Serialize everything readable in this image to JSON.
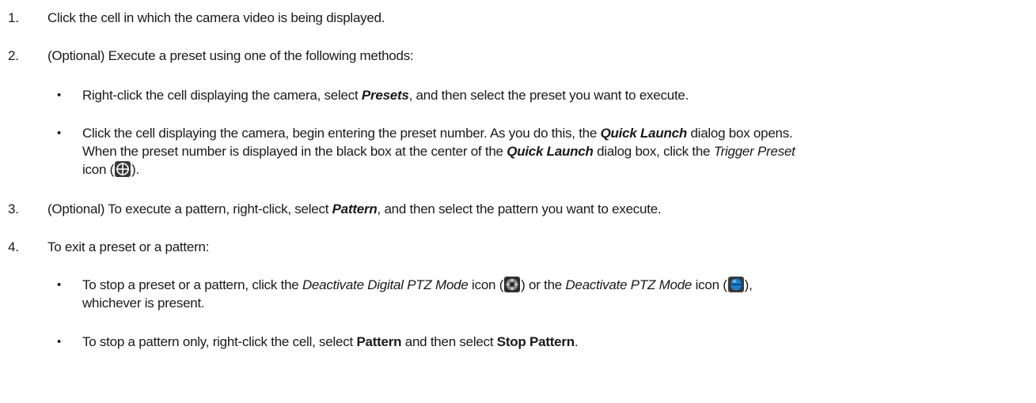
{
  "steps": [
    {
      "number": "1.",
      "text": "Click the cell in which the camera video is being displayed."
    },
    {
      "number": "2.",
      "text": "(Optional) Execute a preset using one of the following methods:",
      "bullets": [
        {
          "pre": "Right-click the cell displaying the camera, select ",
          "em1": "Presets",
          "post": ", and then select the preset you want to execute."
        },
        {
          "line1_pre": "Click the cell displaying the camera, begin entering the preset number. As you do this, the ",
          "line1_em": "Quick Launch",
          "line1_post": " dialog box opens.",
          "line2_pre": "When the preset number is displayed in the black box at the center of the ",
          "line2_em": "Quick Launch",
          "line2_mid": " dialog box, click the ",
          "line2_em2": "Trigger Preset",
          "line3_pre": "icon (",
          "line3_post": ")."
        }
      ]
    },
    {
      "number": "3.",
      "pre": "(Optional) To execute a pattern, right-click, select ",
      "em": "Pattern",
      "post": ", and then select the pattern you want to execute."
    },
    {
      "number": "4.",
      "text": "To exit a preset or a pattern:",
      "bullets": [
        {
          "pre": "To stop a preset or a pattern, click the ",
          "em1": "Deactivate Digital PTZ Mode",
          "mid1": " icon (",
          "mid2": ") or the ",
          "em2": "Deactivate PTZ Mode",
          "mid3": " icon (",
          "post": "),",
          "line2": "whichever is present."
        },
        {
          "pre": "To stop a pattern only, right-click the cell, select ",
          "b1": "Pattern",
          "mid": " and then select ",
          "b2": "Stop Pattern",
          "post": "."
        }
      ]
    }
  ],
  "bullet_char": "•",
  "icons": {
    "trigger_preset": "trigger-preset-icon",
    "deactivate_digital_ptz": "deactivate-digital-ptz-icon",
    "deactivate_ptz": "deactivate-ptz-icon"
  }
}
